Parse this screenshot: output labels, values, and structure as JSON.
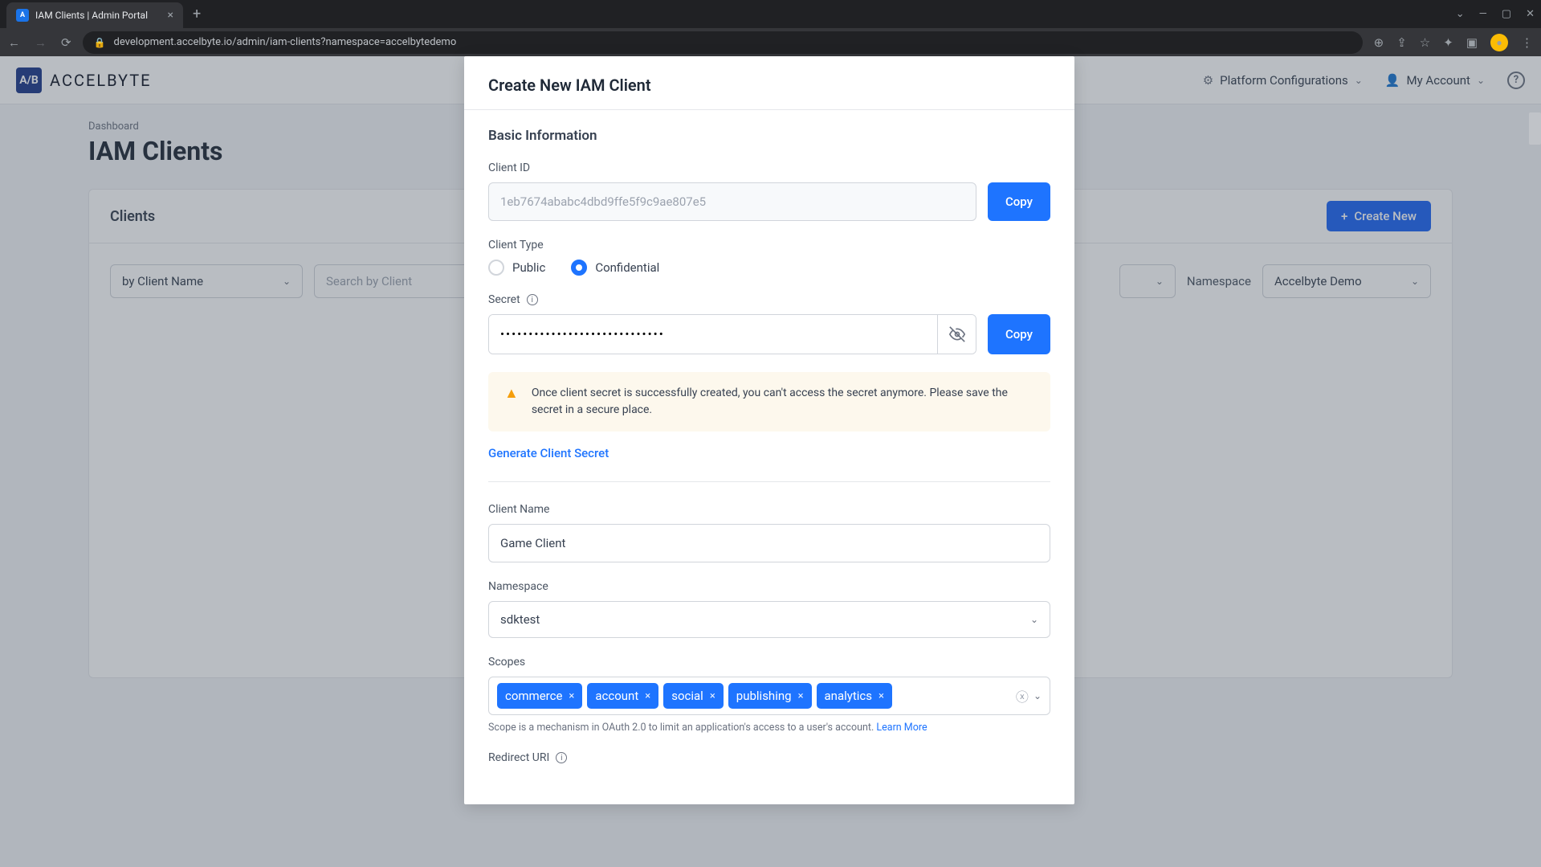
{
  "browser": {
    "tab_title": "IAM Clients | Admin Portal",
    "url": "development.accelbyte.io/admin/iam-clients?namespace=accelbytedemo"
  },
  "header": {
    "logo_mark": "A/B",
    "logo_text": "ACCELBYTE",
    "platform_config": "Platform Configurations",
    "my_account": "My Account"
  },
  "page": {
    "breadcrumb": "Dashboard",
    "title": "IAM Clients"
  },
  "card": {
    "title": "Clients",
    "create_label": "Create New",
    "filter_by": "by Client Name",
    "search_placeholder": "Search by Client",
    "namespace_label": "Namespace",
    "namespace_value": "Accelbyte Demo"
  },
  "modal": {
    "title": "Create New IAM Client",
    "section_basic": "Basic Information",
    "client_id_label": "Client ID",
    "client_id_value": "1eb7674ababc4dbd9ffe5f9c9ae807e5",
    "copy": "Copy",
    "client_type_label": "Client Type",
    "type_public": "Public",
    "type_confidential": "Confidential",
    "secret_label": "Secret",
    "secret_masked": "•••••••••••••••••••••••••••••",
    "warning": "Once client secret is successfully created, you can't access the secret anymore. Please save the secret in a secure place.",
    "generate_secret": "Generate Client Secret",
    "client_name_label": "Client Name",
    "client_name_value": "Game Client",
    "namespace_label": "Namespace",
    "namespace_value": "sdktest",
    "scopes_label": "Scopes",
    "scopes": [
      "commerce",
      "account",
      "social",
      "publishing",
      "analytics"
    ],
    "scopes_hint": "Scope is a mechanism in OAuth 2.0 to limit an application's access to a user's account.",
    "learn_more": "Learn More",
    "redirect_uri_label": "Redirect URI"
  }
}
